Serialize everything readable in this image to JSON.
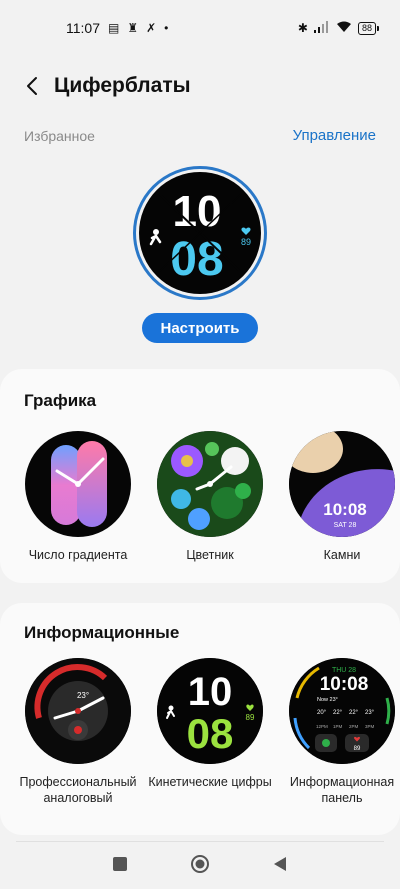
{
  "status": {
    "time": "11:07",
    "battery": "88"
  },
  "header": {
    "title": "Циферблаты"
  },
  "favorites": {
    "label": "Избранное",
    "manage": "Управление",
    "watch": {
      "hour": "10",
      "minute": "08",
      "heart": "89"
    },
    "customize": "Настроить"
  },
  "graphics": {
    "title": "Графика",
    "items": [
      {
        "label": "Число градиента"
      },
      {
        "label": "Цветник"
      },
      {
        "label": "Камни",
        "time": "10:08",
        "date": "SAT 28"
      }
    ]
  },
  "info": {
    "title": "Информационные",
    "items": [
      {
        "label": "Профессиональный аналоговый",
        "temp": "23°"
      },
      {
        "label": "Кинетические цифры",
        "hour": "10",
        "minute": "08",
        "heart": "89"
      },
      {
        "label": "Информационная панель",
        "day": "THU 28",
        "time": "10:08",
        "now": "Now 23°",
        "temps": [
          "20°",
          "22°",
          "22°",
          "23°"
        ],
        "hours": [
          "12PM",
          "1PM",
          "2PM",
          "3PM"
        ],
        "heart": "89"
      }
    ]
  },
  "colors": {
    "accent": "#1a73d9",
    "manage": "#1a73c8"
  }
}
